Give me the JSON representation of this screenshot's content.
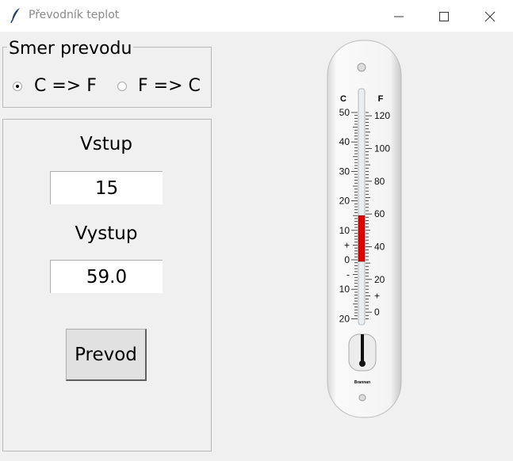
{
  "window": {
    "title": "Převodník teplot",
    "icon": "feather-icon"
  },
  "direction": {
    "label": "Smer prevodu",
    "options": [
      {
        "label": "C => F",
        "selected": true
      },
      {
        "label": "F => C",
        "selected": false
      }
    ]
  },
  "form": {
    "input_label": "Vstup",
    "input_value": "15",
    "output_label": "Vystup",
    "output_value": "59.0",
    "button_label": "Prevod"
  },
  "thermometer": {
    "celsius_header": "C",
    "fahrenheit_header": "F",
    "celsius_labels": [
      "50",
      "40",
      "30",
      "20",
      "10",
      "+",
      "0",
      "-",
      "10",
      "20"
    ],
    "fahrenheit_labels": [
      "120",
      "100",
      "80",
      "60",
      "40",
      "20",
      "+",
      "0"
    ],
    "brand": "Brannan",
    "mercury_color": "#e00000",
    "level_celsius": 15
  }
}
